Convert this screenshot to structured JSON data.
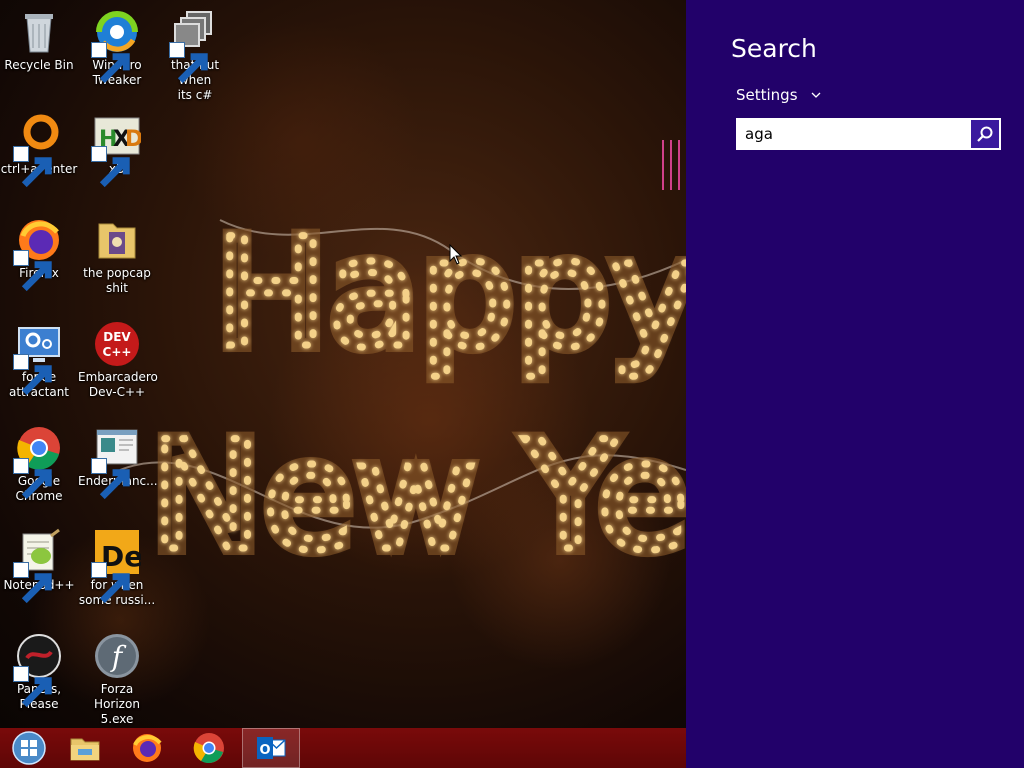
{
  "desktop": {
    "icons": [
      {
        "label": "Recycle Bin"
      },
      {
        "label": "Winaero\nTweaker"
      },
      {
        "label": "that but when\nits c#"
      },
      {
        "label": "ctrl+a, enter"
      },
      {
        "label": "xD"
      },
      {
        "label": "Firefox"
      },
      {
        "label": "the popcap\nshit"
      },
      {
        "label": "forkie\nattractant"
      },
      {
        "label": "Embarcadero\nDev-C++"
      },
      {
        "label": "Google\nChrome"
      },
      {
        "label": "Endermanc..."
      },
      {
        "label": "Notepad++"
      },
      {
        "label": "for when\nsome russi..."
      },
      {
        "label": "Papers, Please"
      },
      {
        "label": "Forza Horizon\n5.exe"
      }
    ],
    "wallpaper": {
      "line1": "Happy",
      "line2": "New Ye"
    }
  },
  "taskbar": {
    "items": [
      "start-button",
      "file-explorer",
      "firefox",
      "chrome",
      "outlook"
    ]
  },
  "search_charm": {
    "title": "Search",
    "scope": "Settings",
    "query": "aga",
    "accent": "#22016a"
  }
}
